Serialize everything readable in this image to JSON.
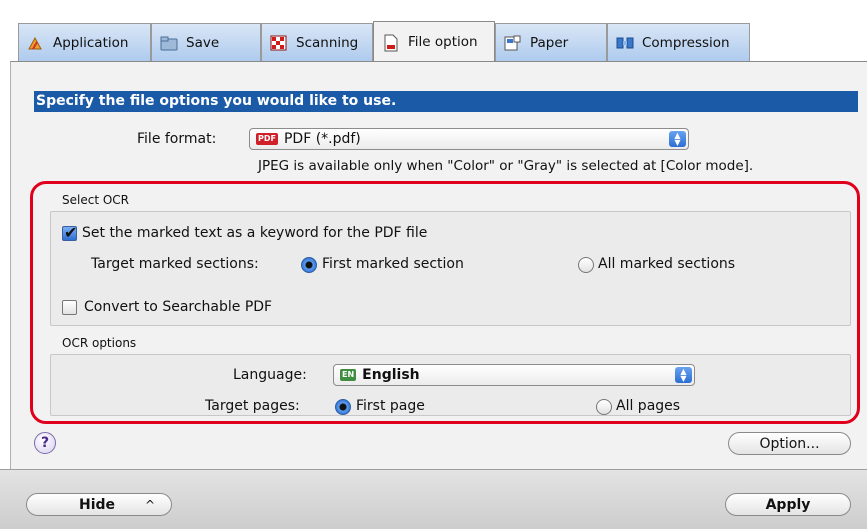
{
  "tabs": [
    {
      "label": "Application",
      "icon": "application-icon"
    },
    {
      "label": "Save",
      "icon": "folder-icon"
    },
    {
      "label": "Scanning",
      "icon": "scanning-icon"
    },
    {
      "label": "File option",
      "icon": "file-icon",
      "active": true
    },
    {
      "label": "Paper",
      "icon": "paper-icon"
    },
    {
      "label": "Compression",
      "icon": "compression-icon"
    }
  ],
  "header": {
    "title": "Specify the file options you would like to use."
  },
  "file_format": {
    "label": "File format:",
    "badge": "PDF",
    "value": "PDF (*.pdf)",
    "note": "JPEG is available only when \"Color\" or \"Gray\" is selected at [Color mode]."
  },
  "select_ocr": {
    "title": "Select OCR",
    "keyword_checkbox": {
      "label": "Set the marked text as a keyword for the PDF file",
      "checked": true
    },
    "target_sections_label": "Target marked sections:",
    "first_marked": "First marked section",
    "all_marked": "All marked sections",
    "searchable_checkbox": {
      "label": "Convert to Searchable PDF",
      "checked": false
    }
  },
  "ocr_options": {
    "title": "OCR options",
    "language_label": "Language:",
    "language_badge": "EN",
    "language_value": "English",
    "target_pages_label": "Target pages:",
    "first_page": "First page",
    "all_pages": "All pages"
  },
  "help": {
    "symbol": "?"
  },
  "buttons": {
    "option": "Option...",
    "hide": "Hide",
    "hide_arrow": "^",
    "apply": "Apply"
  },
  "colors": {
    "accent": "#1b5aa7",
    "highlight": "#e0001b"
  }
}
